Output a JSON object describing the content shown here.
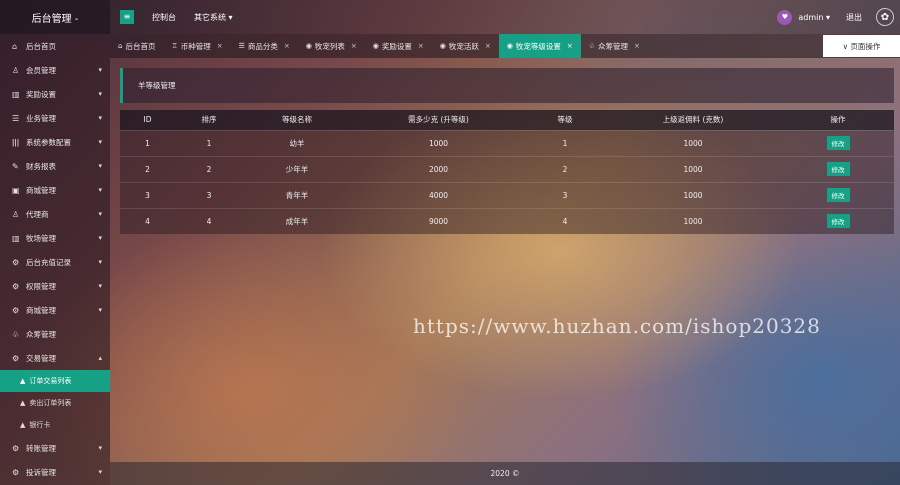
{
  "header": {
    "logo": "后台管理 -",
    "menu_toggle": "≡",
    "links": [
      "控制台",
      "其它系统 ▾"
    ],
    "user": "admin ▾",
    "logout": "退出"
  },
  "sidebar": {
    "items": [
      {
        "icon": "⌂",
        "label": "后台首页",
        "arrow": ""
      },
      {
        "icon": "♙",
        "label": "会员管理",
        "arrow": "▾"
      },
      {
        "icon": "▥",
        "label": "奖励设置",
        "arrow": "▾"
      },
      {
        "icon": "☰",
        "label": "业务管理",
        "arrow": "▾"
      },
      {
        "icon": "ǀǀǀ",
        "label": "系统参数配置",
        "arrow": "▾"
      },
      {
        "icon": "✎",
        "label": "财务报表",
        "arrow": "▾"
      },
      {
        "icon": "▣",
        "label": "商城管理",
        "arrow": "▾"
      },
      {
        "icon": "♙",
        "label": "代理商",
        "arrow": "▾"
      },
      {
        "icon": "▥",
        "label": "牧场管理",
        "arrow": "▾"
      },
      {
        "icon": "⚙",
        "label": "后台充值记录",
        "arrow": "▾"
      },
      {
        "icon": "⚙",
        "label": "权限管理",
        "arrow": "▾"
      },
      {
        "icon": "⚙",
        "label": "商城管理",
        "arrow": "▾"
      },
      {
        "icon": "♧",
        "label": "众筹管理",
        "arrow": ""
      },
      {
        "icon": "⚙",
        "label": "交易管理",
        "arrow": "▴"
      }
    ],
    "sub_items": [
      {
        "icon": "▲",
        "label": "订单交易列表"
      },
      {
        "icon": "▲",
        "label": "卖出订单列表"
      },
      {
        "icon": "▲",
        "label": "银行卡"
      }
    ],
    "bottom_items": [
      {
        "icon": "⚙",
        "label": "转账管理",
        "arrow": "▾"
      },
      {
        "icon": "⚙",
        "label": "投诉管理",
        "arrow": "▾"
      }
    ]
  },
  "tabs": [
    {
      "icon": "⌂",
      "label": "后台首页",
      "close": ""
    },
    {
      "icon": "♖",
      "label": "币种管理",
      "close": "×"
    },
    {
      "icon": "☰",
      "label": "商品分类",
      "close": "×"
    },
    {
      "icon": "◉",
      "label": "牧宠列表",
      "close": "×"
    },
    {
      "icon": "◉",
      "label": "奖励设置",
      "close": "×"
    },
    {
      "icon": "◉",
      "label": "牧宠活跃",
      "close": "×"
    },
    {
      "icon": "◉",
      "label": "牧宠等级设置",
      "close": "×"
    },
    {
      "icon": "♧",
      "label": "众筹管理",
      "close": "×"
    }
  ],
  "page_ops": "∨ 页面操作",
  "section_title": "羊等级管理",
  "table": {
    "headers": [
      "ID",
      "排序",
      "等级名称",
      "需多少克 (升等级)",
      "等级",
      "上级返佣料 (克数)",
      "操作"
    ],
    "rows": [
      [
        "1",
        "1",
        "幼羊",
        "1000",
        "1",
        "1000",
        "修改"
      ],
      [
        "2",
        "2",
        "少年羊",
        "2000",
        "2",
        "1000",
        "修改"
      ],
      [
        "3",
        "3",
        "青年羊",
        "4000",
        "3",
        "1000",
        "修改"
      ],
      [
        "4",
        "4",
        "成年羊",
        "9000",
        "4",
        "1000",
        "修改"
      ]
    ]
  },
  "watermark": "https://www.huzhan.com/ishop20328",
  "footer": "2020 ©",
  "colors": {
    "accent": "#16a086",
    "purple": "#9b59b6"
  }
}
